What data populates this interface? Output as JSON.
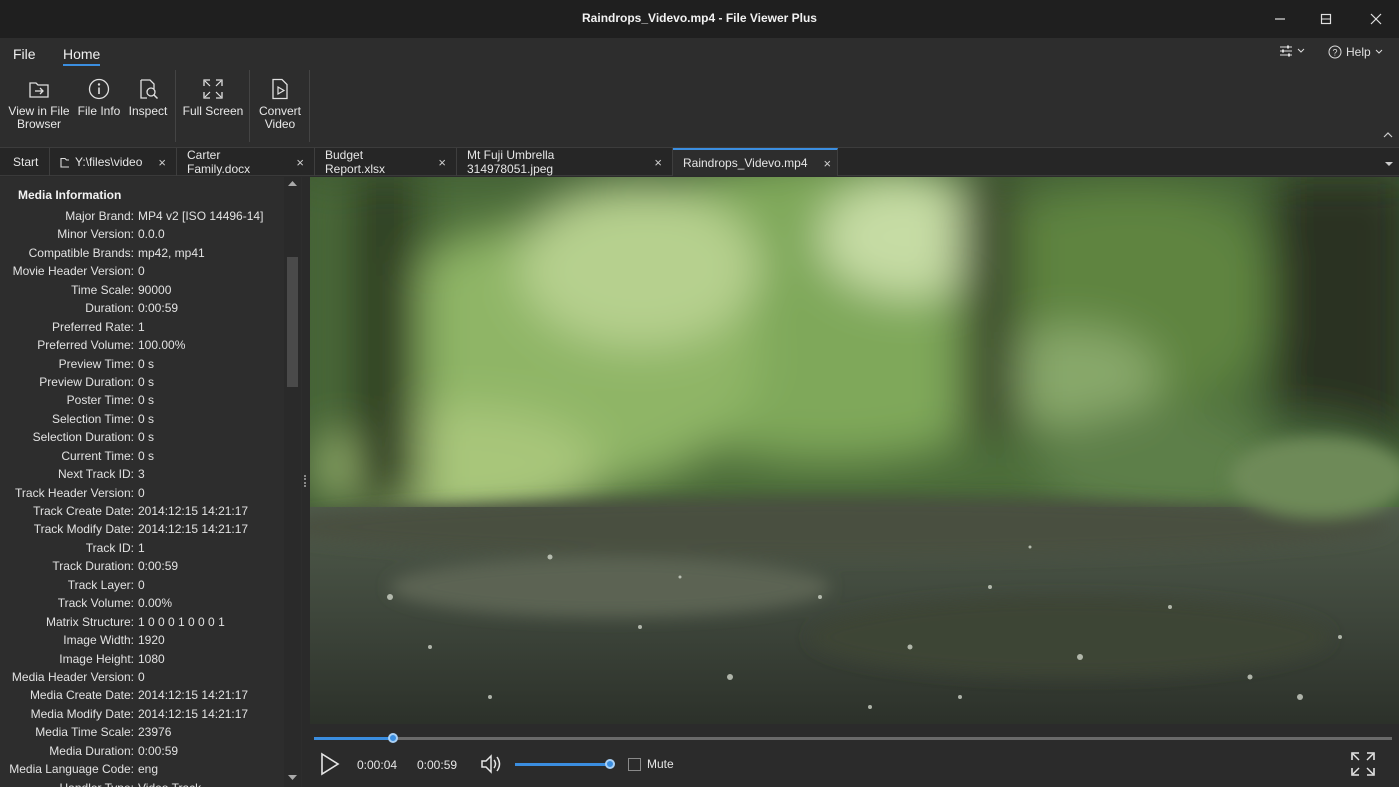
{
  "window": {
    "title": "Raindrops_Videvo.mp4 - File Viewer Plus"
  },
  "menu": {
    "file": "File",
    "home": "Home",
    "settings_icon": "settings-sliders-icon",
    "help": "Help"
  },
  "ribbon": {
    "view_in_browser": [
      "View in File",
      "Browser"
    ],
    "file_info": "File Info",
    "inspect": "Inspect",
    "full_screen": "Full Screen",
    "convert_video": [
      "Convert",
      "Video"
    ]
  },
  "tabs": [
    {
      "label": "Start",
      "closable": false
    },
    {
      "label": "Y:\\files\\video",
      "closable": true,
      "icon": "folder-icon"
    },
    {
      "label": "Carter Family.docx",
      "closable": true
    },
    {
      "label": "Budget Report.xlsx",
      "closable": true
    },
    {
      "label": "Mt Fuji Umbrella 314978051.jpeg",
      "closable": true
    },
    {
      "label": "Raindrops_Videvo.mp4",
      "closable": true,
      "active": true
    }
  ],
  "media_info": {
    "title": "Media Information",
    "rows": [
      {
        "k": "Major Brand:",
        "v": "MP4 v2 [ISO 14496-14]"
      },
      {
        "k": "Minor Version:",
        "v": "0.0.0"
      },
      {
        "k": "Compatible Brands:",
        "v": "mp42, mp41"
      },
      {
        "k": "Movie Header Version:",
        "v": "0"
      },
      {
        "k": "Time Scale:",
        "v": "90000"
      },
      {
        "k": "Duration:",
        "v": "0:00:59"
      },
      {
        "k": "Preferred Rate:",
        "v": "1"
      },
      {
        "k": "Preferred Volume:",
        "v": "100.00%"
      },
      {
        "k": "Preview Time:",
        "v": "0 s"
      },
      {
        "k": "Preview Duration:",
        "v": "0 s"
      },
      {
        "k": "Poster Time:",
        "v": "0 s"
      },
      {
        "k": "Selection Time:",
        "v": "0 s"
      },
      {
        "k": "Selection Duration:",
        "v": "0 s"
      },
      {
        "k": "Current Time:",
        "v": "0 s"
      },
      {
        "k": "Next Track ID:",
        "v": "3"
      },
      {
        "k": "Track Header Version:",
        "v": "0"
      },
      {
        "k": "Track Create Date:",
        "v": "2014:12:15 14:21:17"
      },
      {
        "k": "Track Modify Date:",
        "v": "2014:12:15 14:21:17"
      },
      {
        "k": "Track ID:",
        "v": "1"
      },
      {
        "k": "Track Duration:",
        "v": "0:00:59"
      },
      {
        "k": "Track Layer:",
        "v": "0"
      },
      {
        "k": "Track Volume:",
        "v": "0.00%"
      },
      {
        "k": "Matrix Structure:",
        "v": "1 0 0 0 1 0 0 0 1"
      },
      {
        "k": "Image Width:",
        "v": "1920"
      },
      {
        "k": "Image Height:",
        "v": "1080"
      },
      {
        "k": "Media Header Version:",
        "v": "0"
      },
      {
        "k": "Media Create Date:",
        "v": "2014:12:15 14:21:17"
      },
      {
        "k": "Media Modify Date:",
        "v": "2014:12:15 14:21:17"
      },
      {
        "k": "Media Time Scale:",
        "v": "23976"
      },
      {
        "k": "Media Duration:",
        "v": "0:00:59"
      },
      {
        "k": "Media Language Code:",
        "v": "eng"
      },
      {
        "k": "Handler Type:",
        "v": "Video Track"
      }
    ]
  },
  "player": {
    "current_time": "0:00:04",
    "total_time": "0:00:59",
    "progress": 0.073,
    "volume": 1.0,
    "mute_label": "Mute",
    "muted": false
  },
  "colors": {
    "accent": "#3b8ee0"
  }
}
